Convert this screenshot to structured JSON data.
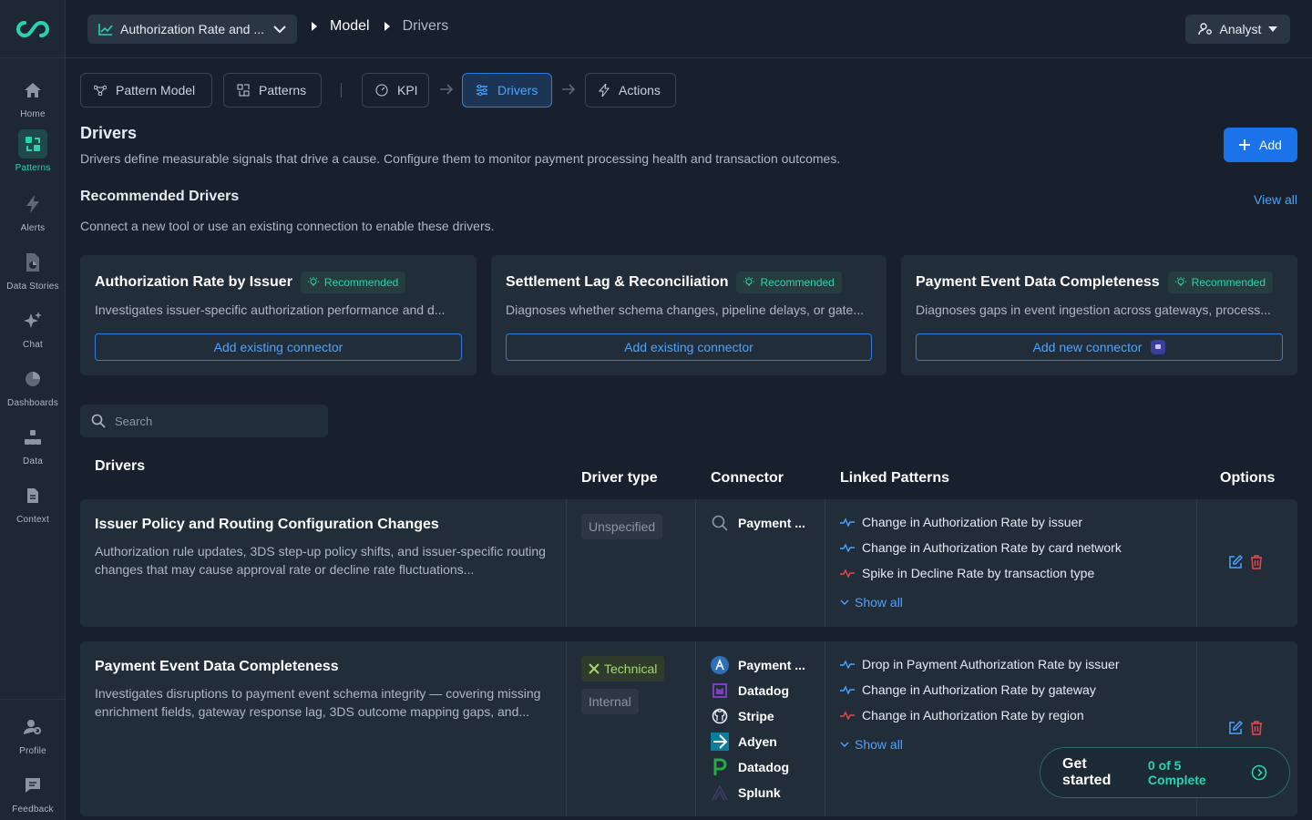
{
  "sidebar": {
    "items": [
      {
        "label": "Home",
        "icon": "home-icon"
      },
      {
        "label": "Patterns",
        "icon": "patterns-icon"
      },
      {
        "label": "Alerts",
        "icon": "lightning-icon"
      },
      {
        "label": "Data Stories",
        "icon": "document-chart-icon"
      },
      {
        "label": "Chat",
        "icon": "sparkle-icon"
      },
      {
        "label": "Dashboards",
        "icon": "pie-chart-icon"
      },
      {
        "label": "Data",
        "icon": "hierarchy-icon"
      },
      {
        "label": "Context",
        "icon": "document-icon"
      }
    ],
    "bottom": [
      {
        "label": "Profile",
        "icon": "user-gear-icon"
      },
      {
        "label": "Feedback",
        "icon": "chat-bubble-icon"
      }
    ]
  },
  "header": {
    "kpi_select": "Authorization Rate and ...",
    "breadcrumb": [
      "Model",
      "Drivers"
    ],
    "role": "Analyst"
  },
  "tabs": {
    "pattern_model": "Pattern Model",
    "patterns": "Patterns",
    "kpi": "KPI",
    "drivers": "Drivers",
    "actions": "Actions"
  },
  "page": {
    "title": "Drivers",
    "description": "Drivers define measurable signals that drive a cause. Configure them to monitor payment processing health and transaction outcomes.",
    "add_label": "Add"
  },
  "recommended": {
    "title": "Recommended Drivers",
    "view_all": "View all",
    "subtitle": "Connect a new tool or use an existing connection to enable these drivers.",
    "cards": [
      {
        "name": "Authorization Rate by Issuer",
        "badge": "Recommended",
        "desc": "Investigates issuer-specific authorization performance and d...",
        "button": "Add existing connector"
      },
      {
        "name": "Settlement Lag & Reconciliation",
        "badge": "Recommended",
        "desc": "Diagnoses whether schema changes, pipeline delays, or gate...",
        "button": "Add existing connector"
      },
      {
        "name": "Payment Event Data Completeness",
        "badge": "Recommended",
        "desc": "Diagnoses gaps in event ingestion across gateways, process...",
        "button": "Add new connector"
      }
    ]
  },
  "search": {
    "placeholder": "Search"
  },
  "table": {
    "headers": {
      "drivers": "Drivers",
      "type": "Driver type",
      "connector": "Connector",
      "patterns": "Linked Patterns",
      "options": "Options"
    },
    "rows": [
      {
        "name": "Issuer Policy and Routing Configuration Changes",
        "desc": "Authorization rule updates, 3DS step-up policy shifts, and issuer-specific routing changes that may cause approval rate or decline rate fluctuations...",
        "types": [
          "Unspecified"
        ],
        "connectors": [
          "Payment ..."
        ],
        "patterns": [
          "Change in Authorization Rate by issuer",
          "Change in Authorization Rate by card network",
          "Spike in Decline Rate by transaction type"
        ],
        "show_all": "Show all"
      },
      {
        "name": "Payment Event Data Completeness",
        "desc": "Investigates disruptions to payment event schema integrity — covering missing enrichment fields, gateway response lag, 3DS outcome mapping gaps, and...",
        "types": [
          "Technical",
          "Internal"
        ],
        "connectors": [
          "Payment ...",
          "Datadog",
          "Stripe",
          "Adyen",
          "Datadog",
          "Splunk"
        ],
        "patterns": [
          "Drop in Payment Authorization Rate by issuer",
          "Change in Authorization Rate by gateway",
          "Change in Authorization Rate by region"
        ],
        "show_all": "Show all"
      }
    ]
  },
  "onboarding": {
    "label": "Get started",
    "progress": "0 of 5 Complete"
  },
  "colors": {
    "accent": "#2bd2b2",
    "primary": "#1a73e8",
    "link": "#4aa3ff",
    "delete": "#e5484d"
  }
}
